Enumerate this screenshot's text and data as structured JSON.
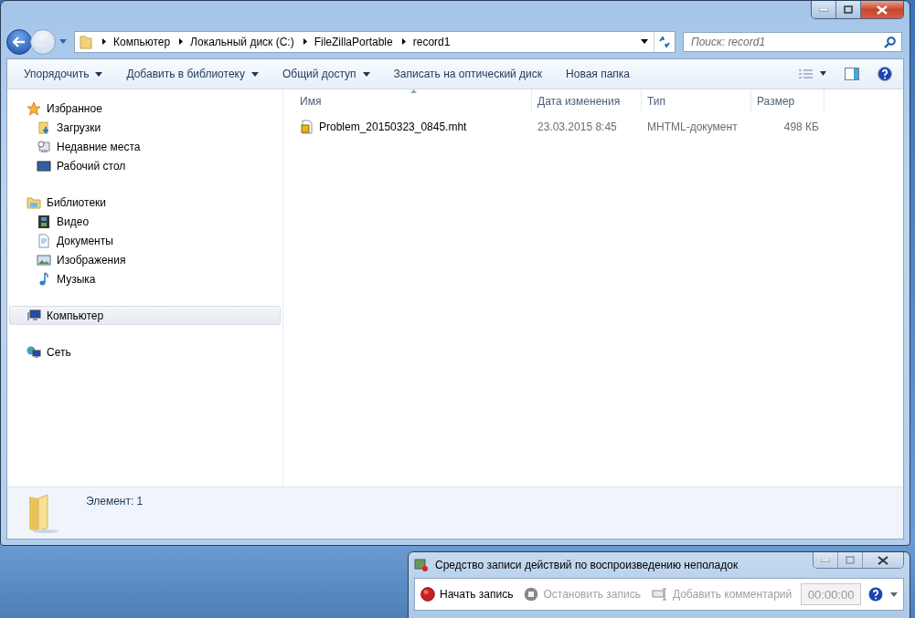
{
  "address_bar": {
    "crumbs": [
      "Компьютер",
      "Локальный диск (C:)",
      "FileZillaPortable",
      "record1"
    ]
  },
  "search": {
    "placeholder": "Поиск: record1"
  },
  "toolbar": [
    {
      "label": "Упорядочить",
      "dropdown": true
    },
    {
      "label": "Добавить в библиотеку",
      "dropdown": true
    },
    {
      "label": "Общий доступ",
      "dropdown": true
    },
    {
      "label": "Записать на оптический диск",
      "dropdown": false
    },
    {
      "label": "Новая папка",
      "dropdown": false
    }
  ],
  "navigation": [
    {
      "label": "Избранное",
      "kind": "star",
      "selected": false,
      "children": [
        {
          "label": "Загрузки",
          "kind": "downloads",
          "selected": false
        },
        {
          "label": "Недавние места",
          "kind": "recent",
          "selected": false
        },
        {
          "label": "Рабочий стол",
          "kind": "desktop",
          "selected": false
        }
      ]
    },
    {
      "label": "Библиотеки",
      "kind": "library",
      "selected": false,
      "children": [
        {
          "label": "Видео",
          "kind": "video",
          "selected": false
        },
        {
          "label": "Документы",
          "kind": "document",
          "selected": false
        },
        {
          "label": "Изображения",
          "kind": "picture",
          "selected": false
        },
        {
          "label": "Музыка",
          "kind": "music",
          "selected": false
        }
      ]
    },
    {
      "label": "Компьютер",
      "kind": "computer",
      "selected": true
    },
    {
      "label": "Сеть",
      "kind": "network",
      "selected": false
    }
  ],
  "columns": [
    {
      "label": "Имя",
      "sorted": true
    },
    {
      "label": "Дата изменения",
      "sorted": false
    },
    {
      "label": "Тип",
      "sorted": false
    },
    {
      "label": "Размер",
      "sorted": false
    }
  ],
  "files": [
    {
      "name": "Problem_20150323_0845.mht",
      "date": "23.03.2015 8:45",
      "type": "MHTML-документ",
      "size": "498 КБ"
    }
  ],
  "details": {
    "text": "Элемент: 1"
  },
  "recorder": {
    "title": "Средство записи действий по воспроизведению неполадок",
    "buttons": [
      {
        "label": "Начать запись",
        "kind": "record",
        "disabled": false
      },
      {
        "label": "Остановить запись",
        "kind": "stop",
        "disabled": true
      },
      {
        "label": "Добавить комментарий",
        "kind": "comment",
        "disabled": true
      }
    ],
    "timer": "00:00:00"
  }
}
